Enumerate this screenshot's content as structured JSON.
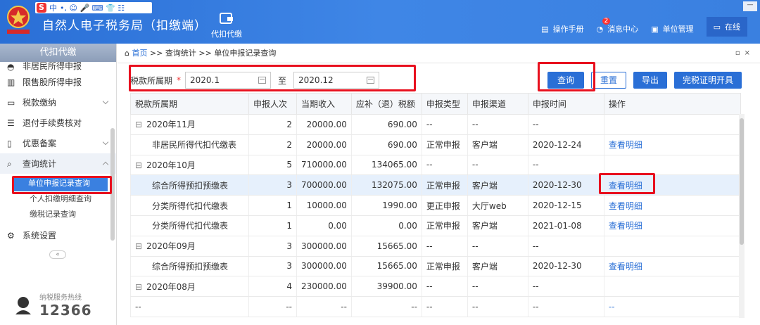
{
  "ime": {
    "label": "中",
    "extras": "•,  ☺  🎤  ⌨  👕  ☷"
  },
  "app": {
    "title": "自然人电子税务局（扣缴端）",
    "topnav": "代扣代缴"
  },
  "header_links": [
    {
      "label": "操作手册"
    },
    {
      "label": "消息中心",
      "badge": "2"
    },
    {
      "label": "单位管理"
    },
    {
      "label": "在线"
    }
  ],
  "sidebar": {
    "head": "代扣代缴",
    "items": [
      {
        "label": "非居民所得申报"
      },
      {
        "label": "限售股所得申报"
      },
      {
        "label": "税款缴纳"
      },
      {
        "label": "退付手续费核对"
      },
      {
        "label": "优惠备案"
      },
      {
        "label": "查询统计"
      }
    ],
    "subitems": [
      {
        "label": "单位申报记录查询"
      },
      {
        "label": "个人扣缴明细查询"
      },
      {
        "label": "缴税记录查询"
      }
    ],
    "settings": "系统设置",
    "collapse": "«",
    "hotline_label": "纳税服务热线",
    "hotline_number": "12366"
  },
  "breadcrumb": {
    "home": "首页",
    "sep": ">>",
    "level2": "查询统计",
    "level3": "单位申报记录查询"
  },
  "filter": {
    "label": "税款所属期",
    "required": "*",
    "from": "2020.1",
    "to_label": "至",
    "to": "2020.12"
  },
  "buttons": {
    "query": "查询",
    "reset": "重置",
    "export": "导出",
    "certificate": "完税证明开具"
  },
  "table": {
    "headers": [
      "税款所属期",
      "申报人次",
      "当期收入",
      "应补（退）税额",
      "申报类型",
      "申报渠道",
      "申报时间",
      "操作"
    ],
    "rows": [
      {
        "period": "2020年11月",
        "count": "2",
        "income": "20000.00",
        "tax": "690.00",
        "type": "--",
        "channel": "--",
        "time": "--",
        "op": "",
        "group": true
      },
      {
        "period": "非居民所得代扣代缴表",
        "count": "2",
        "income": "20000.00",
        "tax": "690.00",
        "type": "正常申报",
        "channel": "客户端",
        "time": "2020-12-24",
        "op": "查看明细",
        "group": false
      },
      {
        "period": "2020年10月",
        "count": "5",
        "income": "710000.00",
        "tax": "134065.00",
        "type": "--",
        "channel": "--",
        "time": "--",
        "op": "",
        "group": true
      },
      {
        "period": "综合所得预扣预缴表",
        "count": "3",
        "income": "700000.00",
        "tax": "132075.00",
        "type": "正常申报",
        "channel": "客户端",
        "time": "2020-12-30",
        "op": "查看明细",
        "group": false
      },
      {
        "period": "分类所得代扣代缴表",
        "count": "1",
        "income": "10000.00",
        "tax": "1990.00",
        "type": "更正申报",
        "channel": "大厅web",
        "time": "2020-12-15",
        "op": "查看明细",
        "group": false
      },
      {
        "period": "分类所得代扣代缴表",
        "count": "1",
        "income": "0.00",
        "tax": "0.00",
        "type": "正常申报",
        "channel": "客户端",
        "time": "2021-01-08",
        "op": "查看明细",
        "group": false
      },
      {
        "period": "2020年09月",
        "count": "3",
        "income": "300000.00",
        "tax": "15665.00",
        "type": "--",
        "channel": "--",
        "time": "--",
        "op": "",
        "group": true
      },
      {
        "period": "综合所得预扣预缴表",
        "count": "3",
        "income": "300000.00",
        "tax": "15665.00",
        "type": "正常申报",
        "channel": "客户端",
        "time": "2020-12-30",
        "op": "查看明细",
        "group": false
      },
      {
        "period": "2020年08月",
        "count": "4",
        "income": "230000.00",
        "tax": "39900.00",
        "type": "--",
        "channel": "--",
        "time": "--",
        "op": "",
        "group": true
      },
      {
        "period": "--",
        "count": "--",
        "income": "--",
        "tax": "--",
        "type": "--",
        "channel": "--",
        "time": "--",
        "op": "--",
        "group": false
      }
    ]
  }
}
